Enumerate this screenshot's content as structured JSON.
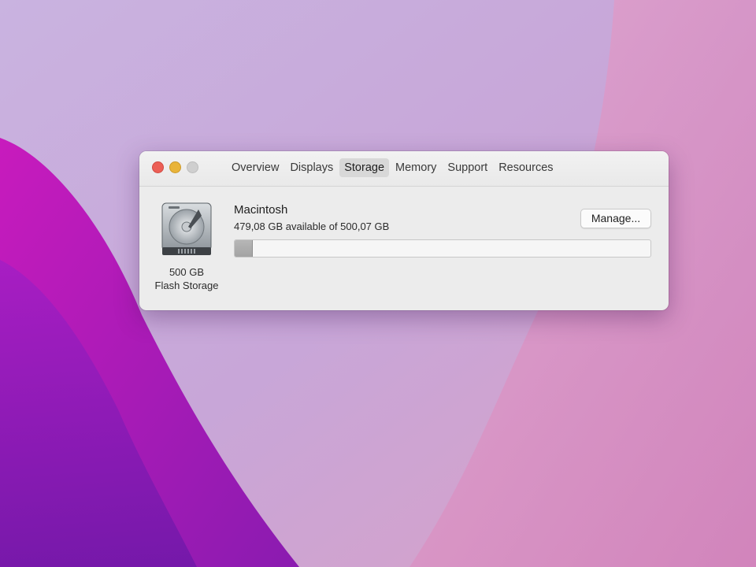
{
  "window": {
    "tabs": [
      {
        "label": "Overview",
        "active": false
      },
      {
        "label": "Displays",
        "active": false
      },
      {
        "label": "Storage",
        "active": true
      },
      {
        "label": "Memory",
        "active": false
      },
      {
        "label": "Support",
        "active": false
      },
      {
        "label": "Resources",
        "active": false
      }
    ]
  },
  "storage": {
    "disk_icon": "hard-drive-icon",
    "disk_capacity": "500 GB",
    "disk_type": "Flash Storage",
    "volume_name": "Macintosh",
    "available_text": "479,08 GB available of 500,07 GB",
    "used_fraction": 0.042,
    "manage_label": "Manage..."
  },
  "colors": {
    "close": "#ec5f56",
    "minimize": "#e9b43a",
    "zoom_disabled": "#cfcfcf",
    "wallpaper_magenta": "#b21ac4",
    "wallpaper_lavender": "#c8a8dc"
  }
}
